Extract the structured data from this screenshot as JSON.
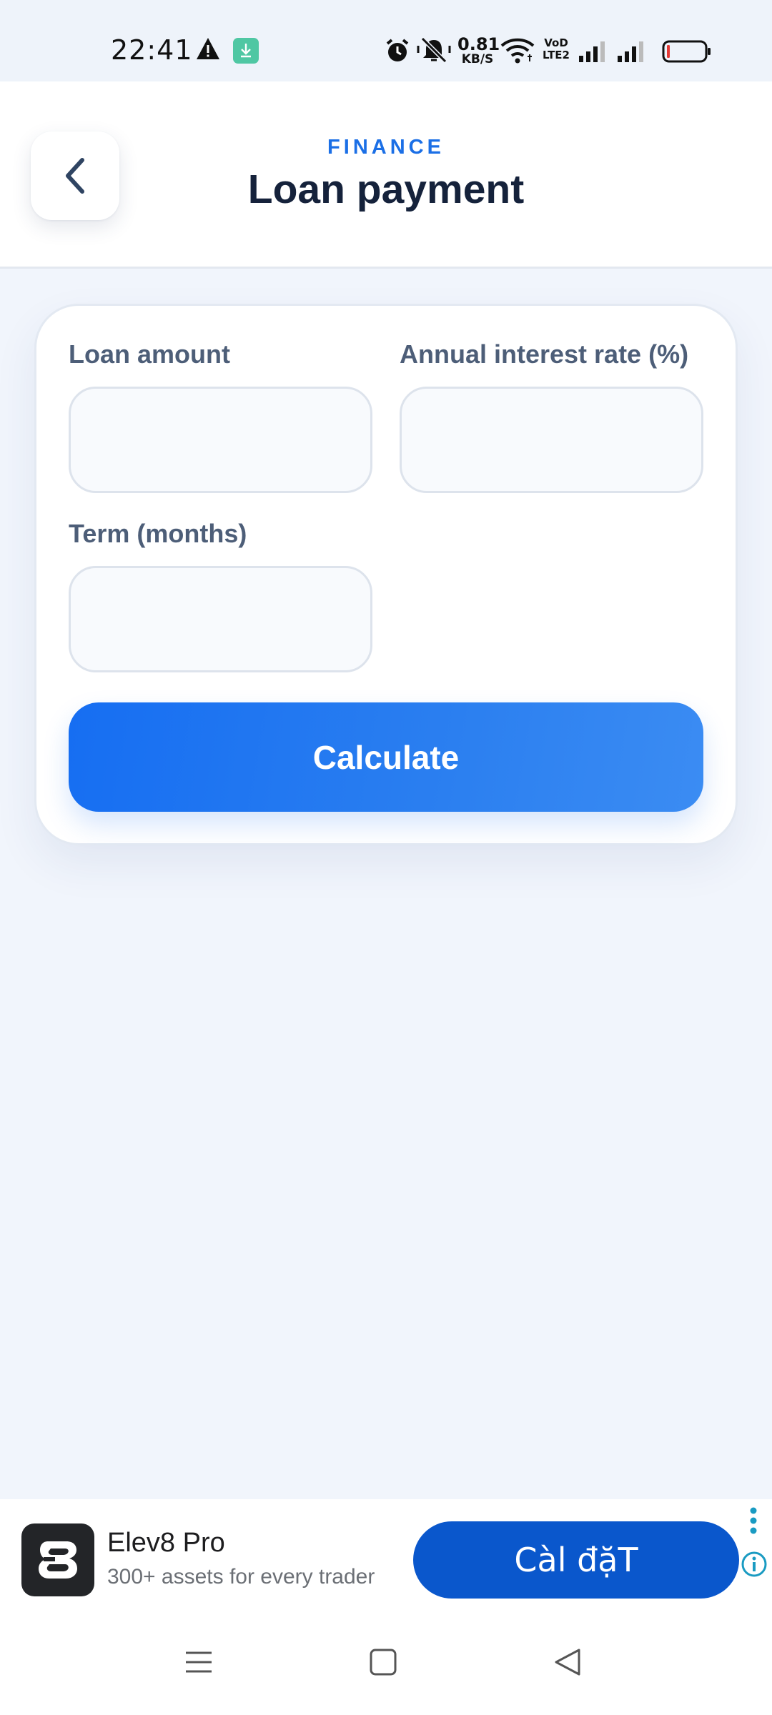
{
  "status_bar": {
    "time": "22:41",
    "net_speed_value": "0.81",
    "net_speed_unit": "KB/S",
    "left_icons": [
      "warning-icon",
      "download-icon"
    ],
    "right_icons": [
      "alarm-icon",
      "mute-icon",
      "wifi-icon",
      "volte-icon",
      "signal-icon",
      "signal-icon",
      "battery-icon"
    ],
    "volte_text": "VoD LTE2"
  },
  "header": {
    "eyebrow": "FINANCE",
    "title": "Loan payment",
    "back_icon": "chevron-left-icon"
  },
  "form": {
    "loan_amount_label": "Loan amount",
    "interest_rate_label": "Annual interest rate (%)",
    "term_label": "Term (months)",
    "loan_amount_value": "",
    "interest_rate_value": "",
    "term_value": "",
    "calculate_label": "Calculate"
  },
  "ad": {
    "title": "Elev8 Pro",
    "subtitle": "300+ assets for every trader",
    "install_label": "Càl đặT"
  },
  "nav": {
    "icons": [
      "menu-icon",
      "home-square-icon",
      "back-triangle-icon"
    ]
  },
  "colors": {
    "accent": "#1b6fe6",
    "title": "#15223b",
    "label": "#4d5e78",
    "button": "#166ef2",
    "ad_button": "#0a57cc",
    "background": "#f1f5fc"
  }
}
